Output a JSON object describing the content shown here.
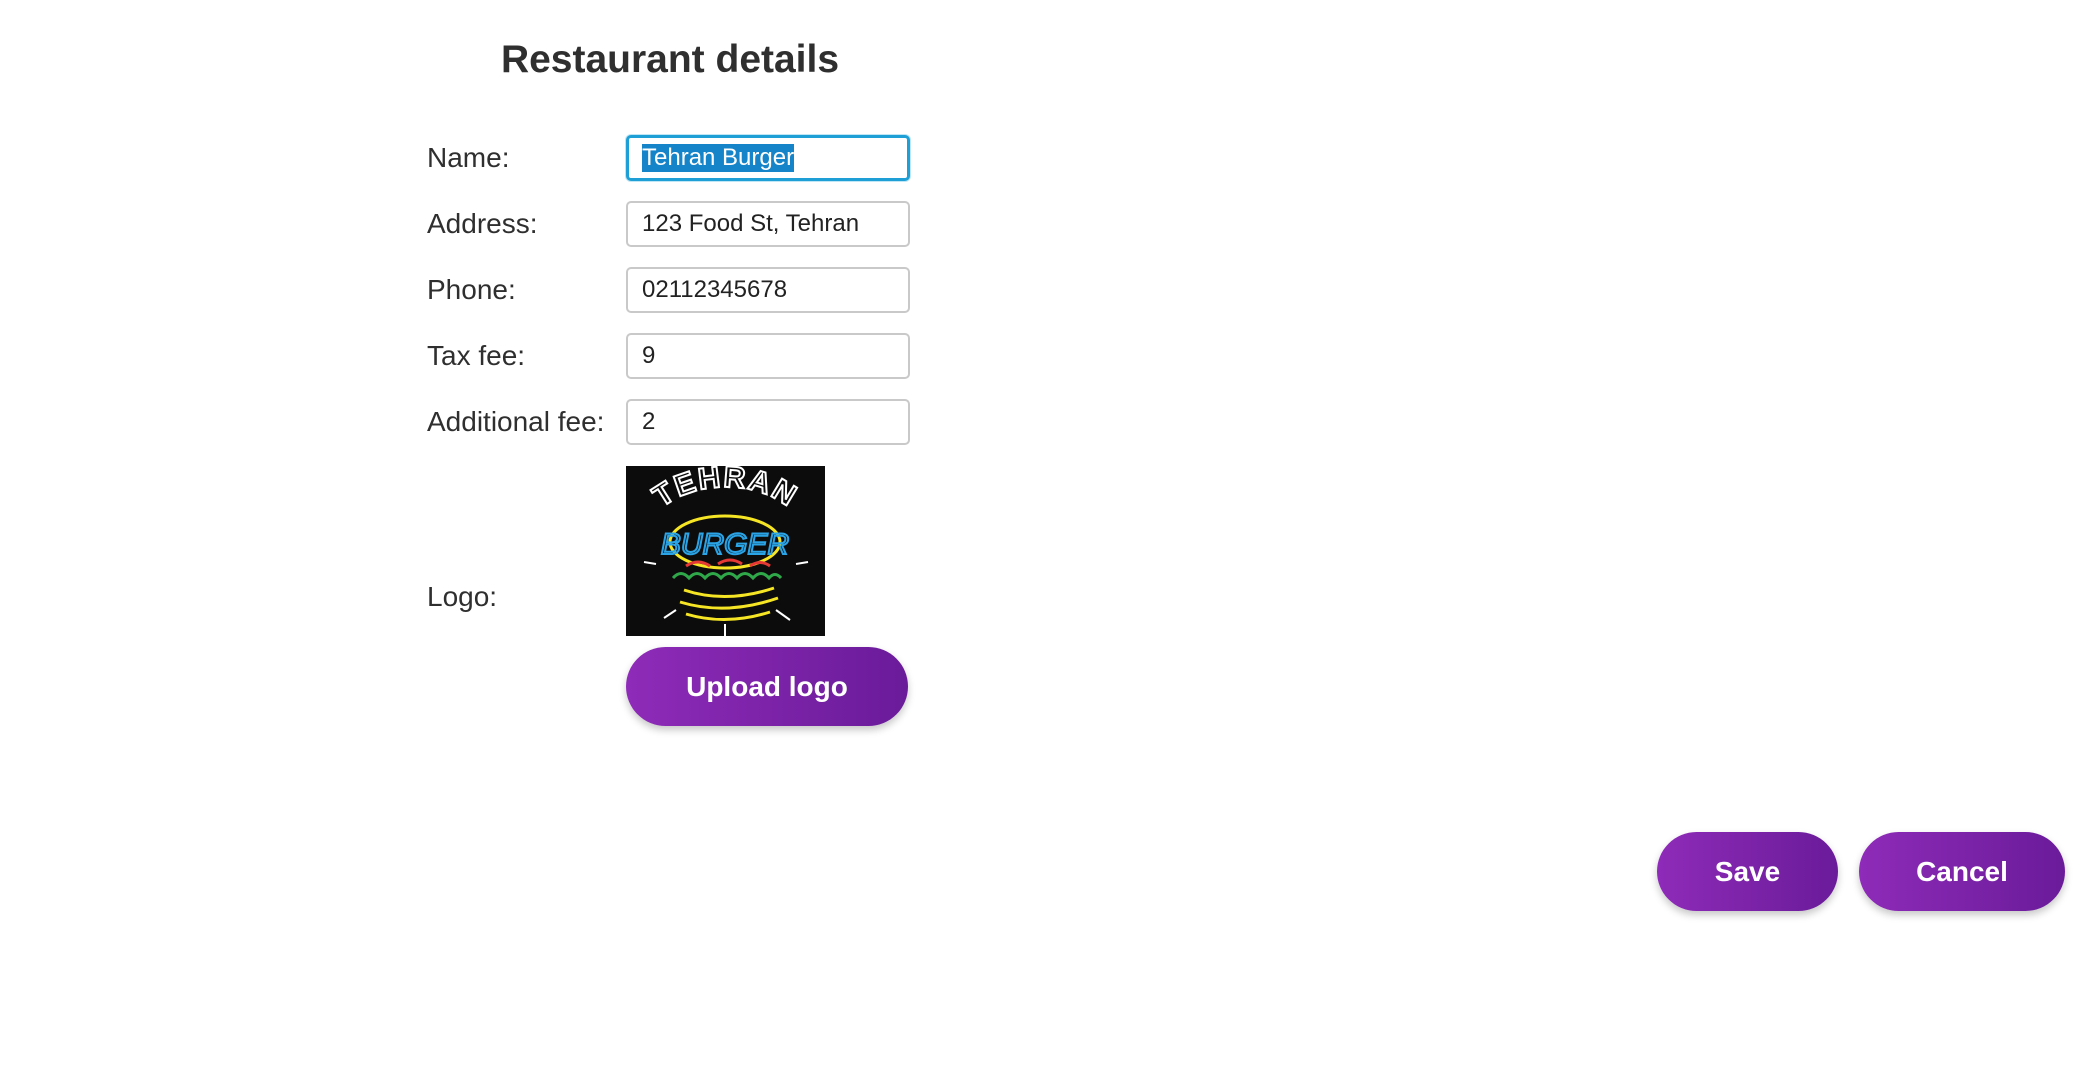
{
  "page": {
    "title": "Restaurant details"
  },
  "form": {
    "name": {
      "label": "Name:",
      "value": "Tehran Burger"
    },
    "address": {
      "label": "Address:",
      "value": "123 Food St, Tehran"
    },
    "phone": {
      "label": "Phone:",
      "value": "02112345678"
    },
    "tax_fee": {
      "label": "Tax fee:",
      "value": "9"
    },
    "additional_fee": {
      "label": "Additional fee:",
      "value": "2"
    },
    "logo": {
      "label": "Logo:",
      "image_text_top": "TEHRAN",
      "image_text_center": "BURGER"
    }
  },
  "buttons": {
    "upload_logo": "Upload logo",
    "save": "Save",
    "cancel": "Cancel"
  },
  "colors": {
    "button_gradient_start": "#8e2bb8",
    "button_gradient_end": "#6a1b9a",
    "focus_border": "#1ea0d6",
    "selection": "#1684c8"
  }
}
